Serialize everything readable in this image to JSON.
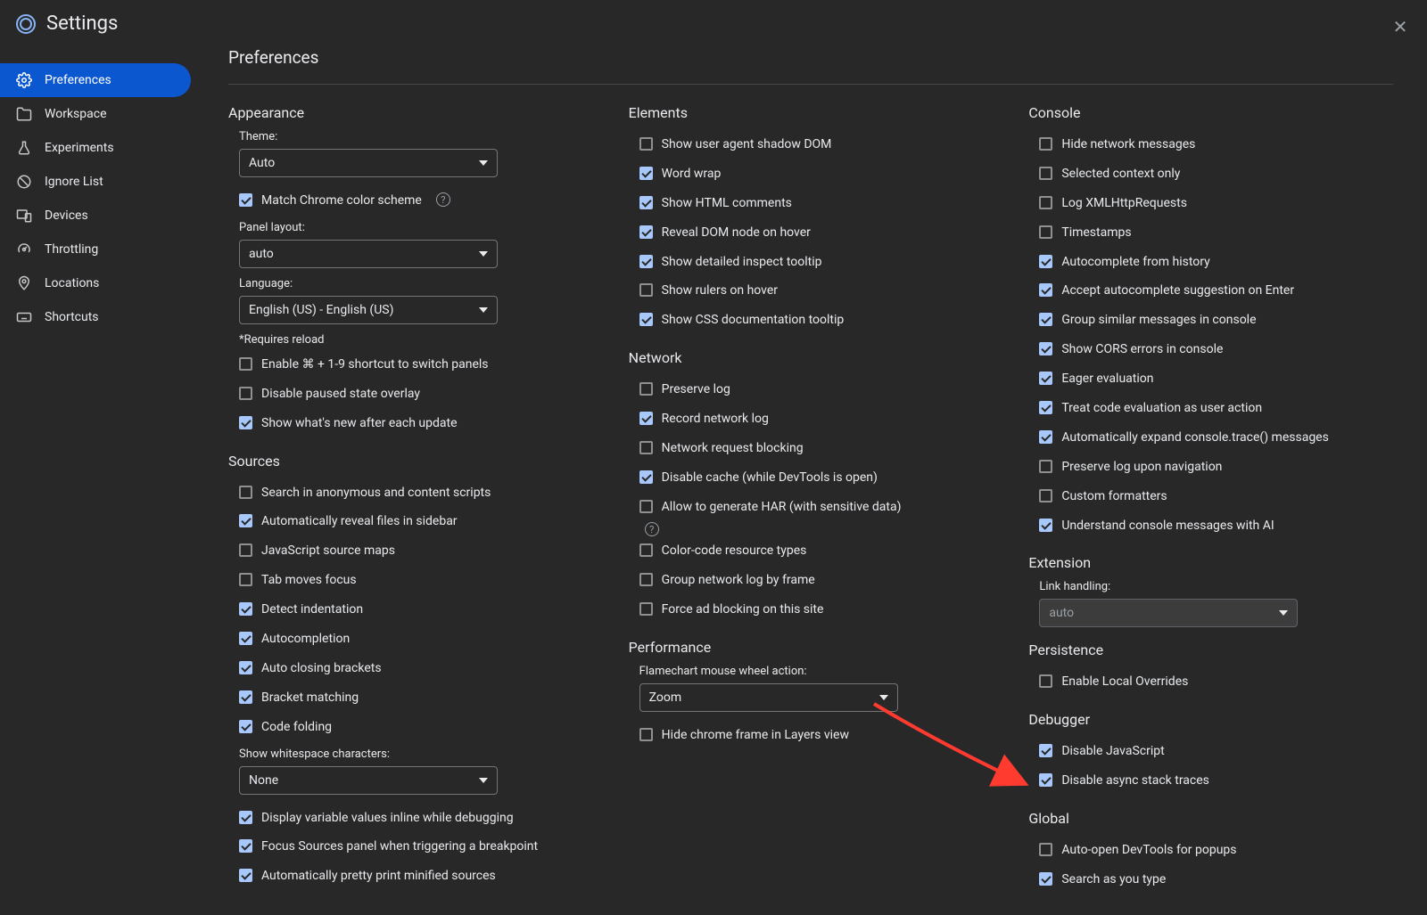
{
  "app": {
    "title": "Settings",
    "page_title": "Preferences"
  },
  "sidebar": {
    "items": [
      {
        "id": "preferences",
        "label": "Preferences",
        "icon": "gear"
      },
      {
        "id": "workspace",
        "label": "Workspace",
        "icon": "folder"
      },
      {
        "id": "experiments",
        "label": "Experiments",
        "icon": "flask"
      },
      {
        "id": "ignore-list",
        "label": "Ignore List",
        "icon": "cancel"
      },
      {
        "id": "devices",
        "label": "Devices",
        "icon": "devices"
      },
      {
        "id": "throttling",
        "label": "Throttling",
        "icon": "speed"
      },
      {
        "id": "locations",
        "label": "Locations",
        "icon": "location"
      },
      {
        "id": "shortcuts",
        "label": "Shortcuts",
        "icon": "keyboard"
      }
    ]
  },
  "appearance": {
    "title": "Appearance",
    "theme_label": "Theme:",
    "theme_value": "Auto",
    "match_chrome": "Match Chrome color scheme",
    "panel_layout_label": "Panel layout:",
    "panel_layout_value": "auto",
    "language_label": "Language:",
    "language_value": "English (US) - English (US)",
    "requires_reload": "*Requires reload",
    "enable_shortcut": "Enable ⌘ + 1-9 shortcut to switch panels",
    "disable_paused": "Disable paused state overlay",
    "show_whats_new": "Show what's new after each update"
  },
  "sources": {
    "title": "Sources",
    "search_anon": "Search in anonymous and content scripts",
    "auto_reveal": "Automatically reveal files in sidebar",
    "js_source_maps": "JavaScript source maps",
    "tab_moves": "Tab moves focus",
    "detect_indent": "Detect indentation",
    "autocomplete": "Autocompletion",
    "auto_closing": "Auto closing brackets",
    "bracket_match": "Bracket matching",
    "code_folding": "Code folding",
    "whitespace_label": "Show whitespace characters:",
    "whitespace_value": "None",
    "display_var": "Display variable values inline while debugging",
    "focus_sources": "Focus Sources panel when triggering a breakpoint",
    "pretty_print": "Automatically pretty print minified sources"
  },
  "elements": {
    "title": "Elements",
    "shadow_dom": "Show user agent shadow DOM",
    "word_wrap": "Word wrap",
    "html_comments": "Show HTML comments",
    "reveal_dom": "Reveal DOM node on hover",
    "detailed_tooltip": "Show detailed inspect tooltip",
    "rulers": "Show rulers on hover",
    "css_docs": "Show CSS documentation tooltip"
  },
  "network": {
    "title": "Network",
    "preserve_log": "Preserve log",
    "record_log": "Record network log",
    "request_blocking": "Network request blocking",
    "disable_cache": "Disable cache (while DevTools is open)",
    "allow_har": "Allow to generate HAR (with sensitive data)",
    "color_code": "Color-code resource types",
    "group_frame": "Group network log by frame",
    "force_ad": "Force ad blocking on this site"
  },
  "performance": {
    "title": "Performance",
    "flame_label": "Flamechart mouse wheel action:",
    "flame_value": "Zoom",
    "hide_chrome_frame": "Hide chrome frame in Layers view"
  },
  "console": {
    "title": "Console",
    "hide_network": "Hide network messages",
    "selected_context": "Selected context only",
    "log_xhr": "Log XMLHttpRequests",
    "timestamps": "Timestamps",
    "autocomplete_history": "Autocomplete from history",
    "accept_enter": "Accept autocomplete suggestion on Enter",
    "group_similar": "Group similar messages in console",
    "show_cors": "Show CORS errors in console",
    "eager_eval": "Eager evaluation",
    "treat_code": "Treat code evaluation as user action",
    "auto_expand": "Automatically expand console.trace() messages",
    "preserve_nav": "Preserve log upon navigation",
    "custom_fmt": "Custom formatters",
    "understand_ai": "Understand console messages with AI"
  },
  "extension": {
    "title": "Extension",
    "link_label": "Link handling:",
    "link_value": "auto"
  },
  "persistence": {
    "title": "Persistence",
    "local_overrides": "Enable Local Overrides"
  },
  "debugger": {
    "title": "Debugger",
    "disable_js": "Disable JavaScript",
    "disable_async": "Disable async stack traces"
  },
  "global": {
    "title": "Global",
    "auto_open": "Auto-open DevTools for popups",
    "search_type": "Search as you type"
  }
}
